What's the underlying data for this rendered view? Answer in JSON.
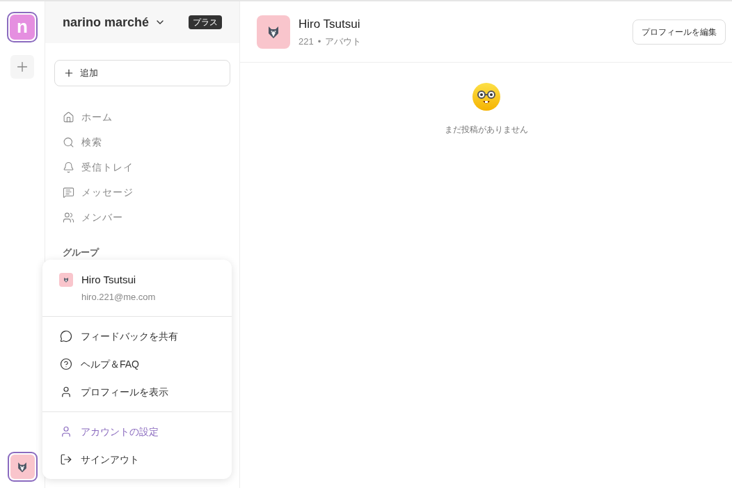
{
  "rail": {
    "logo_letter": "n"
  },
  "sidebar": {
    "workspace_name": "narino marché",
    "plan_badge": "プラス",
    "add_button": "追加",
    "section_heading": "グループ",
    "nav_items": [
      {
        "label": "ホーム"
      },
      {
        "label": "検索"
      },
      {
        "label": "受信トレイ"
      },
      {
        "label": "メッセージ"
      },
      {
        "label": "メンバー"
      }
    ]
  },
  "profile": {
    "name": "Hiro Tsutsui",
    "count": "221",
    "separator": "•",
    "about_link": "アバウト",
    "edit_button": "プロフィールを編集"
  },
  "empty_state": {
    "message": "まだ投稿がありません"
  },
  "account_menu": {
    "name": "Hiro Tsutsui",
    "email": "hiro.221@me.com",
    "sections": [
      [
        {
          "label": "フィードバックを共有",
          "selected": false
        },
        {
          "label": "ヘルプ＆FAQ",
          "selected": false
        },
        {
          "label": "プロフィールを表示",
          "selected": false
        }
      ],
      [
        {
          "label": "アカウントの設定",
          "selected": true
        },
        {
          "label": "サインアウト",
          "selected": false
        }
      ]
    ]
  }
}
